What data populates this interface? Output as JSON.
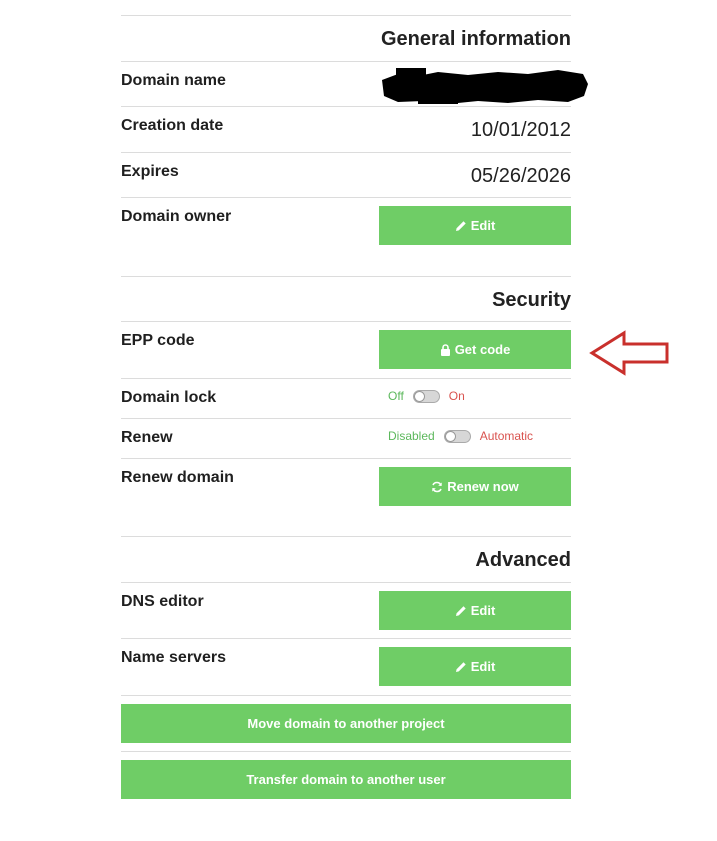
{
  "general": {
    "title": "General information",
    "domain_name_label": "Domain name",
    "creation_date_label": "Creation date",
    "creation_date_value": "10/01/2012",
    "expires_label": "Expires",
    "expires_value": "05/26/2026",
    "domain_owner_label": "Domain owner",
    "domain_owner_button": "Edit"
  },
  "security": {
    "title": "Security",
    "epp_label": "EPP code",
    "epp_button": "Get code",
    "lock_label": "Domain lock",
    "lock_off": "Off",
    "lock_on": "On",
    "renew_label": "Renew",
    "renew_off": "Disabled",
    "renew_on": "Automatic",
    "renew_domain_label": "Renew domain",
    "renew_domain_button": "Renew now"
  },
  "advanced": {
    "title": "Advanced",
    "dns_label": "DNS editor",
    "dns_button": "Edit",
    "ns_label": "Name servers",
    "ns_button": "Edit",
    "move_button": "Move domain to another project",
    "transfer_button": "Transfer domain to another user"
  },
  "colors": {
    "button_green": "#6fcd66",
    "toggle_off_text": "#5cb85c",
    "toggle_on_text": "#d9534f",
    "annotation_arrow": "#c9302c"
  },
  "icons": {
    "edit": "pencil-icon",
    "get_code": "lock-icon",
    "renew": "refresh-icon"
  }
}
